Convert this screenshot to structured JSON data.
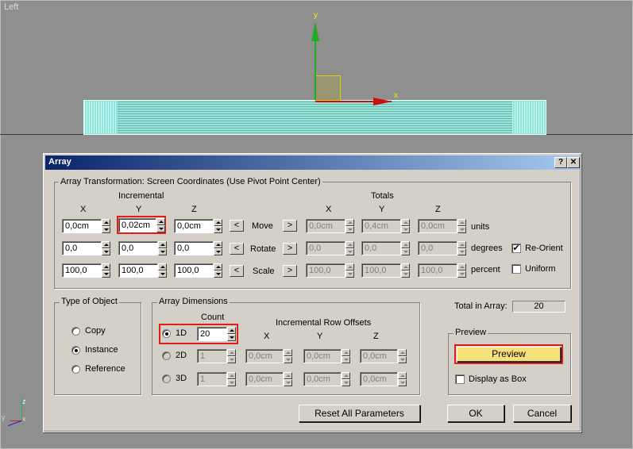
{
  "viewport": {
    "label": "Left",
    "axis_x": "x",
    "axis_y": "y",
    "corner_z": "z",
    "corner_x": "x",
    "corner_y": "y"
  },
  "dialog": {
    "title": "Array",
    "help_label": "?",
    "close_label": "✕",
    "transformation": {
      "group_title": "Array Transformation: Screen Coordinates (Use Pivot Point Center)",
      "incremental_label": "Incremental",
      "totals_label": "Totals",
      "axes": [
        "X",
        "Y",
        "Z"
      ],
      "rows": [
        {
          "label": "Move",
          "unit": "units",
          "inc": [
            "0,0cm",
            "0,02cm",
            "0,0cm"
          ],
          "tot": [
            "0,0cm",
            "0,4cm",
            "0,0cm"
          ]
        },
        {
          "label": "Rotate",
          "unit": "degrees",
          "inc": [
            "0,0",
            "0,0",
            "0,0"
          ],
          "tot": [
            "0,0",
            "0,0",
            "0,0"
          ]
        },
        {
          "label": "Scale",
          "unit": "percent",
          "inc": [
            "100,0",
            "100,0",
            "100,0"
          ],
          "tot": [
            "100,0",
            "100,0",
            "100,0"
          ]
        }
      ],
      "arrow_left": "<",
      "arrow_right": ">",
      "reorient_label": "Re-Orient",
      "reorient_checked": true,
      "uniform_label": "Uniform",
      "uniform_checked": false
    },
    "type_of_object": {
      "group_title": "Type of Object",
      "options": [
        "Copy",
        "Instance",
        "Reference"
      ],
      "selected": "Instance"
    },
    "dimensions": {
      "group_title": "Array Dimensions",
      "count_label": "Count",
      "offsets_label": "Incremental Row Offsets",
      "axes": [
        "X",
        "Y",
        "Z"
      ],
      "rows": [
        {
          "label": "1D",
          "count": "20",
          "offsets": []
        },
        {
          "label": "2D",
          "count": "1",
          "offsets": [
            "0,0cm",
            "0,0cm",
            "0,0cm"
          ]
        },
        {
          "label": "3D",
          "count": "1",
          "offsets": [
            "0,0cm",
            "0,0cm",
            "0,0cm"
          ]
        }
      ],
      "selected": "1D"
    },
    "total_in_array_label": "Total in Array:",
    "total_in_array_value": "20",
    "preview": {
      "group_title": "Preview",
      "button_label": "Preview",
      "display_as_box_label": "Display as Box",
      "display_as_box_checked": false
    },
    "reset_label": "Reset All Parameters",
    "ok_label": "OK",
    "cancel_label": "Cancel"
  },
  "colors": {
    "highlight": "#e21b1b",
    "preview_button": "#f6e07a",
    "titlebar": "#0a246a"
  }
}
